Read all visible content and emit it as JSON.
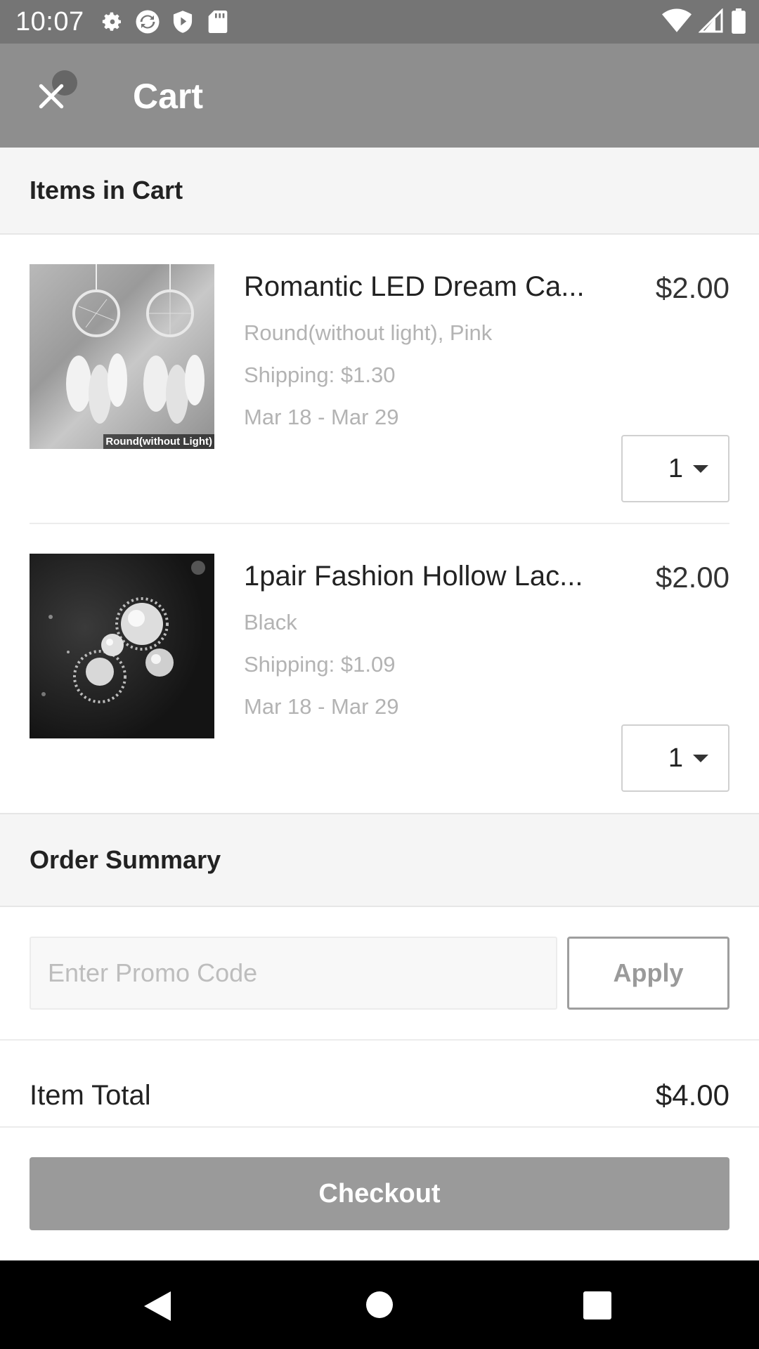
{
  "status_bar": {
    "time": "10:07",
    "icons_left": [
      "settings-gear-icon",
      "sync-icon",
      "shield-icon",
      "sd-card-icon"
    ],
    "icons_right": [
      "wifi-icon",
      "signal-icon",
      "battery-icon"
    ]
  },
  "toolbar": {
    "title": "Cart",
    "close_icon": "close-icon"
  },
  "items_section": {
    "header": "Items in Cart"
  },
  "items": [
    {
      "name": "Romantic LED Dream Ca...",
      "price": "$2.00",
      "variant": "Round(without light), Pink",
      "shipping": "Shipping: $1.30",
      "dates": "Mar 18 - Mar 29",
      "quantity": "1",
      "thumb_caption": "Round(without Light)"
    },
    {
      "name": "1pair Fashion Hollow Lac...",
      "price": "$2.00",
      "variant": "Black",
      "shipping": "Shipping: $1.09",
      "dates": "Mar 18 - Mar 29",
      "quantity": "1"
    }
  ],
  "summary": {
    "header": "Order Summary",
    "promo_placeholder": "Enter Promo Code",
    "promo_value": "",
    "apply_label": "Apply",
    "item_total_label": "Item Total",
    "item_total_value": "$4.00"
  },
  "checkout": {
    "label": "Checkout"
  },
  "colors": {
    "toolbar_bg": "#8e8e8e",
    "status_bar_bg": "#757575",
    "checkout_bg": "#9a9a9a",
    "section_bg": "#f5f5f5"
  }
}
